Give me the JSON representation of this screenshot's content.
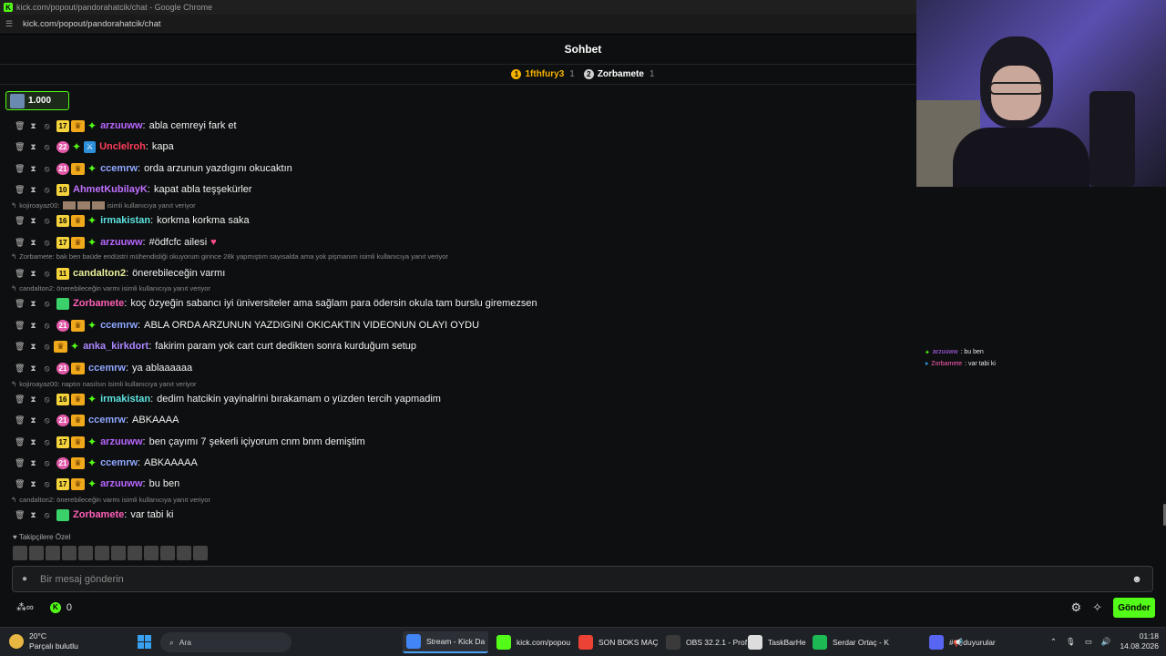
{
  "window": {
    "title": "kick.com/popout/pandorahatcik/chat - Google Chrome",
    "url": "kick.com/popout/pandorahatcik/chat"
  },
  "header": {
    "title": "Sohbet"
  },
  "top_gifters": [
    {
      "rank": "1",
      "name": "1fthfury3",
      "count": "1"
    },
    {
      "rank": "2",
      "name": "Zorbamete",
      "count": "1"
    }
  ],
  "pinned": {
    "amount": "1.000"
  },
  "messages": [
    {
      "type": "msg",
      "sub": "17",
      "subStyle": "y",
      "crown": true,
      "spark": true,
      "user": "arzuuww",
      "color": "#b866ff",
      "text": "abla cemreyi fark et"
    },
    {
      "type": "msg",
      "sub": "22",
      "subStyle": "p",
      "spark": true,
      "mod": true,
      "user": "Unclelroh",
      "color": "#ff3d5a",
      "text": "kapa"
    },
    {
      "type": "msg",
      "sub": "21",
      "subStyle": "p",
      "crown": true,
      "spark": true,
      "user": "ccemrw",
      "color": "#8fa7ff",
      "text": "orda arzunun yazdıgını okucaktın"
    },
    {
      "type": "msg",
      "sub": "10",
      "subStyle": "y",
      "user": "AhmetKubilayK",
      "color": "#c070ff",
      "text": "kapat abla teşşekürler"
    },
    {
      "type": "reply",
      "text": "kojiroayaz00:",
      "emotes": 3,
      "suffix": "isimli kullanıcıya yanıt veriyor"
    },
    {
      "type": "msg",
      "sub": "16",
      "subStyle": "y",
      "crown": true,
      "spark": true,
      "user": "irmakistan",
      "color": "#5de3e0",
      "text": "korkma korkma saka"
    },
    {
      "type": "msg",
      "sub": "17",
      "subStyle": "y",
      "crown": true,
      "spark": true,
      "user": "arzuuww",
      "color": "#b866ff",
      "text": "#ödfcfc ailesi",
      "heart": true
    },
    {
      "type": "reply",
      "text": "Zorbamete: bak ben baüde endüstri mühendisliği okuyorum girince 28k yapmıştım sayısalda ama yok pişmanım isimli kullanıcıya yanıt veriyor"
    },
    {
      "type": "msg",
      "sub": "11",
      "subStyle": "y",
      "user": "candalton2",
      "color": "#e9f09a",
      "text": "önerebileceğin varmı"
    },
    {
      "type": "reply",
      "text": "candalton2: önerebileceğin varmı isimli kullanıcıya yanıt veriyor"
    },
    {
      "type": "msg",
      "sub": "",
      "subStyle": "g",
      "user": "Zorbamete",
      "color": "#ff5fb8",
      "text": "koç özyeğin sabancı iyi üniversiteler ama sağlam para ödersin okula tam burslu giremezsen"
    },
    {
      "type": "msg",
      "sub": "21",
      "subStyle": "p",
      "crown": true,
      "spark": true,
      "user": "ccemrw",
      "color": "#8fa7ff",
      "text": "ABLA ORDA ARZUNUN YAZDIGINI OKICAKTIN VIDEONUN OLAYI OYDU"
    },
    {
      "type": "msg",
      "sub": "",
      "subStyle": "",
      "crown": true,
      "spark": true,
      "user": "anka_kirkdort",
      "color": "#ab87ff",
      "text": "fakirim param yok cart curt dedikten sonra kurduğum setup"
    },
    {
      "type": "msg",
      "sub": "21",
      "subStyle": "p",
      "crown": true,
      "user": "ccemrw",
      "color": "#8fa7ff",
      "text": "ya ablaaaaaa"
    },
    {
      "type": "reply",
      "text": "kojiroayaz00: naptın nasılsın isimli kullanıcıya yanıt veriyor"
    },
    {
      "type": "msg",
      "sub": "16",
      "subStyle": "y",
      "crown": true,
      "spark": true,
      "user": "irmakistan",
      "color": "#5de3e0",
      "text": "dedim hatcikin yayinalrini bırakamam o yüzden tercih yapmadim"
    },
    {
      "type": "msg",
      "sub": "21",
      "subStyle": "p",
      "crown": true,
      "user": "ccemrw",
      "color": "#8fa7ff",
      "text": "ABKAAAA"
    },
    {
      "type": "msg",
      "sub": "17",
      "subStyle": "y",
      "crown": true,
      "spark": true,
      "user": "arzuuww",
      "color": "#b866ff",
      "text": "ben çayımı 7 şekerli içiyorum cnm bnm demiştim"
    },
    {
      "type": "msg",
      "sub": "21",
      "subStyle": "p",
      "crown": true,
      "spark": true,
      "user": "ccemrw",
      "color": "#8fa7ff",
      "text": "ABKAAAAA"
    },
    {
      "type": "msg",
      "sub": "17",
      "subStyle": "y",
      "crown": true,
      "spark": true,
      "user": "arzuuww",
      "color": "#b866ff",
      "text": "bu ben"
    },
    {
      "type": "reply",
      "text": "candalton2: önerebileceğin varmı isimli kullanıcıya yanıt veriyor"
    },
    {
      "type": "msg",
      "sub": "",
      "subStyle": "g",
      "user": "Zorbamete",
      "color": "#ff5fb8",
      "text": "var tabi ki"
    }
  ],
  "followers_label": "Takipçilere Özel",
  "input": {
    "placeholder": "Bir mesaj gönderin"
  },
  "bottom": {
    "points": "0",
    "send_label": "Gönder"
  },
  "overlay_chat": [
    {
      "user": "arzuuww",
      "color": "#b866ff",
      "text": ": bu ben"
    },
    {
      "user": "Zorbamete",
      "color": "#ff5fb8",
      "text": ": var tabi ki"
    }
  ],
  "taskbar": {
    "weather_temp": "20°C",
    "weather_desc": "Parçalı bulutlu",
    "search_label": "Ara",
    "apps": [
      {
        "label": "Stream - Kick Da",
        "color": "#4285f4",
        "active": true
      },
      {
        "label": "kick.com/popou",
        "color": "#53fc18",
        "active": false
      },
      {
        "label": "SON BOKS MAÇ",
        "color": "#ea4335",
        "active": false
      },
      {
        "label": "OBS 32.2.1 - Prof",
        "color": "#3a3a3a",
        "active": false
      },
      {
        "label": "TaskBarHe",
        "color": "#dddddd",
        "active": false
      },
      {
        "label": "Serdar Ortaç - K",
        "color": "#1db954",
        "active": false
      },
      {
        "label": "#📢duyurular",
        "color": "#5865f2",
        "active": false
      }
    ],
    "time": "01:18",
    "date": "14.08.2026"
  },
  "colors": {
    "accent": "#53fc18",
    "background": "#0e0f10"
  }
}
